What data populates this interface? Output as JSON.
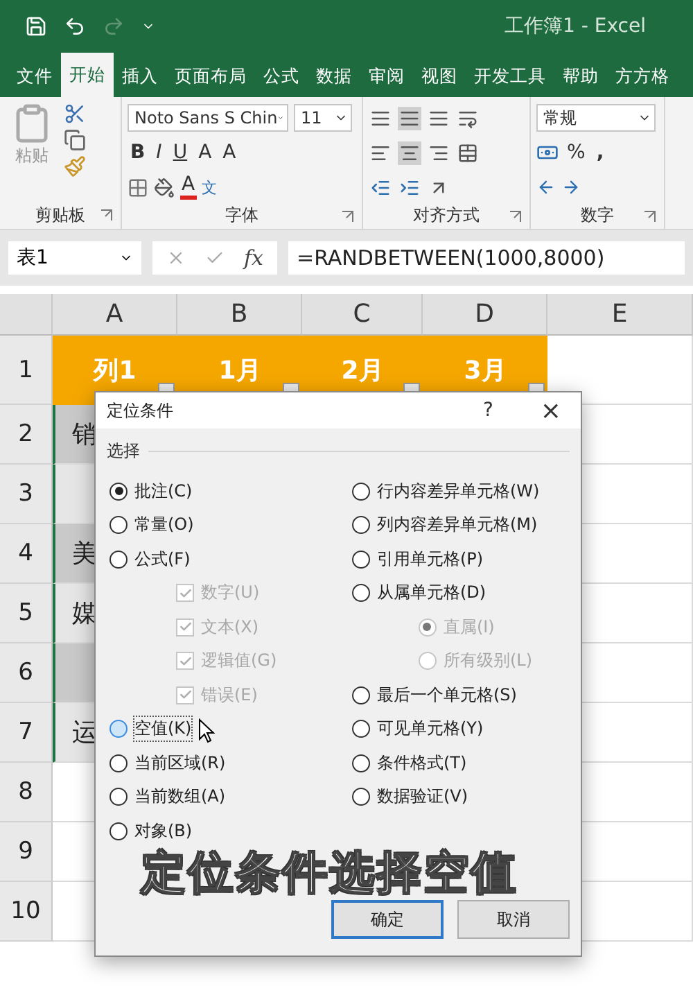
{
  "title_bar": {
    "title": "工作簿1 - Excel"
  },
  "tabs": [
    {
      "label": "文件",
      "selected": false
    },
    {
      "label": "开始",
      "selected": true
    },
    {
      "label": "插入",
      "selected": false
    },
    {
      "label": "页面布局",
      "selected": false
    },
    {
      "label": "公式",
      "selected": false
    },
    {
      "label": "数据",
      "selected": false
    },
    {
      "label": "审阅",
      "selected": false
    },
    {
      "label": "视图",
      "selected": false
    },
    {
      "label": "开发工具",
      "selected": false
    },
    {
      "label": "帮助",
      "selected": false
    },
    {
      "label": "方方格",
      "selected": false
    }
  ],
  "ribbon": {
    "clipboard": {
      "paste": "粘贴",
      "label": "剪贴板"
    },
    "font": {
      "name": "Noto Sans S Chin",
      "size": "11",
      "bold": "B",
      "italic": "I",
      "underline": "U",
      "grow": "A",
      "shrink": "A",
      "font_color": "A",
      "phonetic": "文",
      "label": "字体"
    },
    "alignment": {
      "label": "对齐方式"
    },
    "number": {
      "format": "常规",
      "percent": "%",
      "comma": ",",
      "label": "数字"
    }
  },
  "formula_bar": {
    "name_box": "表1",
    "function_label": "fx",
    "formula": "=RANDBETWEEN(1000,8000)"
  },
  "columns": [
    "A",
    "B",
    "C",
    "D",
    "E"
  ],
  "header_row": {
    "number": "1",
    "cells": [
      "列1",
      "1月",
      "2月",
      "3月"
    ]
  },
  "rows": [
    {
      "number": "2",
      "text": "销",
      "shaded": true,
      "selected": true
    },
    {
      "number": "3",
      "shaded": false,
      "selected": true
    },
    {
      "number": "4",
      "text": "美",
      "shaded": true,
      "selected": true
    },
    {
      "number": "5",
      "text": "媒",
      "shaded": false,
      "selected": true
    },
    {
      "number": "6",
      "shaded": true,
      "selected": true
    },
    {
      "number": "7",
      "text": "运",
      "shaded": false,
      "selected": true
    },
    {
      "number": "8",
      "shaded": false,
      "selected": false
    },
    {
      "number": "9",
      "shaded": false,
      "selected": false
    },
    {
      "number": "10",
      "shaded": false,
      "selected": false
    }
  ],
  "dialog": {
    "title": "定位条件",
    "help": "?",
    "close": "×",
    "section": "选择",
    "left": [
      {
        "kind": "radio",
        "label": "批注(C)",
        "selected": true,
        "hovered": false,
        "disabled": false
      },
      {
        "kind": "radio",
        "label": "常量(O)",
        "selected": false,
        "hovered": false,
        "disabled": false
      },
      {
        "kind": "radio",
        "label": "公式(F)",
        "selected": false,
        "hovered": false,
        "disabled": false
      },
      {
        "kind": "check",
        "label": "数字(U)",
        "checked": true,
        "disabled": true
      },
      {
        "kind": "check",
        "label": "文本(X)",
        "checked": true,
        "disabled": true
      },
      {
        "kind": "check",
        "label": "逻辑值(G)",
        "checked": true,
        "disabled": true
      },
      {
        "kind": "check",
        "label": "错误(E)",
        "checked": true,
        "disabled": true
      },
      {
        "kind": "radio",
        "label": "空值(K)",
        "selected": false,
        "hovered": true,
        "disabled": false
      },
      {
        "kind": "radio",
        "label": "当前区域(R)",
        "selected": false,
        "hovered": false,
        "disabled": false
      },
      {
        "kind": "radio",
        "label": "当前数组(A)",
        "selected": false,
        "hovered": false,
        "disabled": false
      },
      {
        "kind": "radio",
        "label": "对象(B)",
        "selected": false,
        "hovered": false,
        "disabled": false
      }
    ],
    "right": [
      {
        "kind": "radio",
        "label": "行内容差异单元格(W)",
        "selected": false,
        "hovered": false,
        "disabled": false
      },
      {
        "kind": "radio",
        "label": "列内容差异单元格(M)",
        "selected": false,
        "hovered": false,
        "disabled": false
      },
      {
        "kind": "radio",
        "label": "引用单元格(P)",
        "selected": false,
        "hovered": false,
        "disabled": false
      },
      {
        "kind": "radio",
        "label": "从属单元格(D)",
        "selected": false,
        "hovered": false,
        "disabled": false
      },
      {
        "kind": "subradio",
        "label": "直属(I)",
        "selected": true,
        "hovered": false,
        "disabled": true
      },
      {
        "kind": "subradio",
        "label": "所有级别(L)",
        "selected": false,
        "hovered": false,
        "disabled": true
      },
      {
        "kind": "radio",
        "label": "最后一个单元格(S)",
        "selected": false,
        "hovered": false,
        "disabled": false
      },
      {
        "kind": "radio",
        "label": "可见单元格(Y)",
        "selected": false,
        "hovered": false,
        "disabled": false
      },
      {
        "kind": "radio",
        "label": "条件格式(T)",
        "selected": false,
        "hovered": false,
        "disabled": false
      },
      {
        "kind": "radio",
        "label": "数据验证(V)",
        "selected": false,
        "hovered": false,
        "disabled": false
      }
    ],
    "buttons": [
      {
        "label": "确定",
        "default": true
      },
      {
        "label": "取消",
        "default": false
      }
    ]
  },
  "caption": "定位条件选择空值"
}
